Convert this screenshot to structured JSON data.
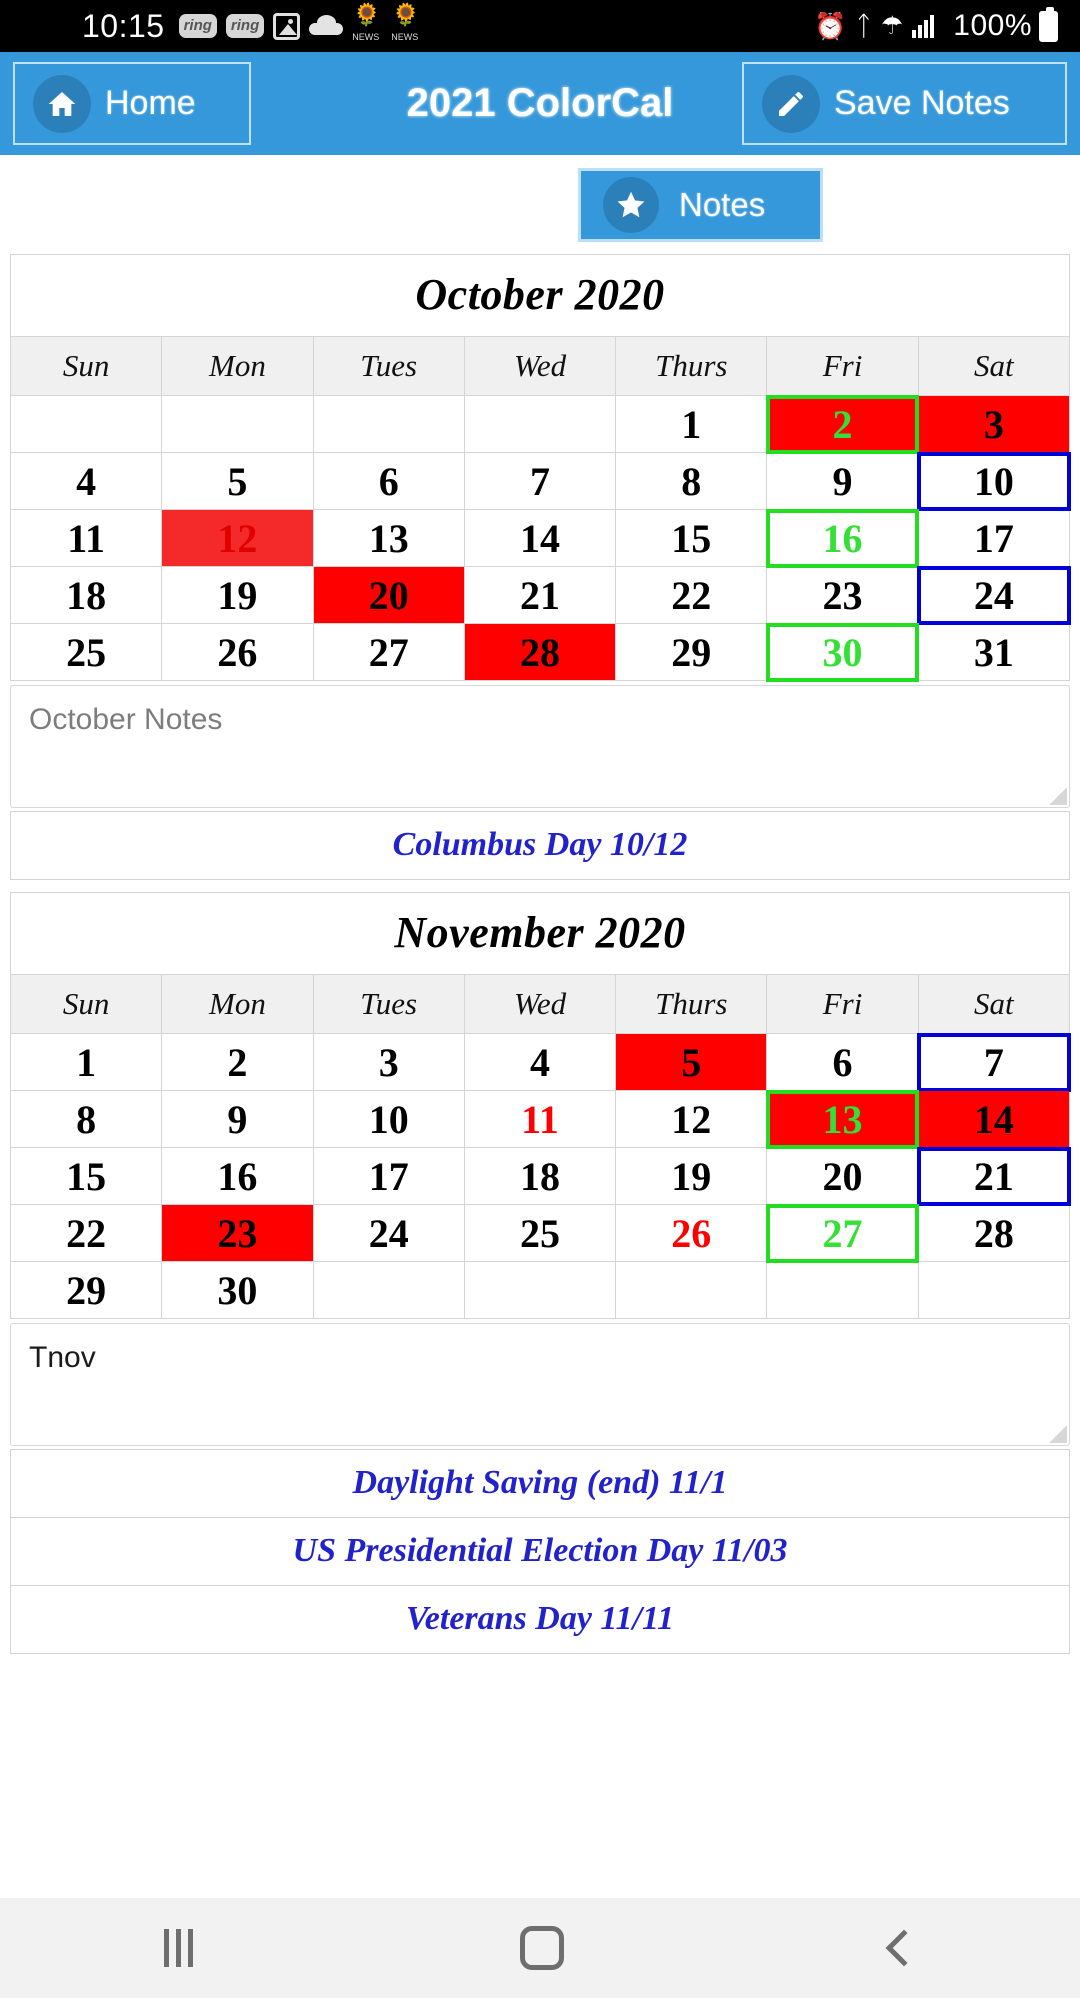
{
  "status_bar": {
    "clock": "10:15",
    "battery_percent": "100%",
    "icons": [
      "ring-icon",
      "ring-icon",
      "image-icon",
      "cloud-icon",
      "nbc-news-icon",
      "nbc-news-icon",
      "alarm-icon",
      "bluetooth-icon",
      "wifi-icon",
      "signal-icon",
      "battery-icon"
    ],
    "ring_label": "ring",
    "nbc_label": "NEWS"
  },
  "header": {
    "home_label": "Home",
    "title": "2021 ColorCal",
    "save_notes_label": "Save Notes",
    "accent_color": "#3498db"
  },
  "toolbar": {
    "notes_label": "Notes"
  },
  "colors": {
    "red_bg": "#fe0000",
    "green_text": "#33e033",
    "green_border": "#22dd22",
    "blue_border": "#0000d8",
    "holiday_text": "#2222cc"
  },
  "months": [
    {
      "title": "October 2020",
      "dow": [
        "Sun",
        "Mon",
        "Tues",
        "Wed",
        "Thurs",
        "Fri",
        "Sat"
      ],
      "weeks": [
        [
          {
            "n": ""
          },
          {
            "n": ""
          },
          {
            "n": ""
          },
          {
            "n": ""
          },
          {
            "n": "1"
          },
          {
            "n": "2",
            "bg": "red",
            "text": "green",
            "border": "green"
          },
          {
            "n": "3",
            "bg": "red"
          }
        ],
        [
          {
            "n": "4"
          },
          {
            "n": "5"
          },
          {
            "n": "6"
          },
          {
            "n": "7"
          },
          {
            "n": "8"
          },
          {
            "n": "9"
          },
          {
            "n": "10",
            "border": "blue"
          }
        ],
        [
          {
            "n": "11"
          },
          {
            "n": "12",
            "bg": "red2",
            "text": "dred"
          },
          {
            "n": "13"
          },
          {
            "n": "14"
          },
          {
            "n": "15"
          },
          {
            "n": "16",
            "text": "green",
            "border": "green"
          },
          {
            "n": "17"
          }
        ],
        [
          {
            "n": "18"
          },
          {
            "n": "19"
          },
          {
            "n": "20",
            "bg": "red"
          },
          {
            "n": "21"
          },
          {
            "n": "22"
          },
          {
            "n": "23"
          },
          {
            "n": "24",
            "border": "blue"
          }
        ],
        [
          {
            "n": "25"
          },
          {
            "n": "26"
          },
          {
            "n": "27"
          },
          {
            "n": "28",
            "bg": "red"
          },
          {
            "n": "29"
          },
          {
            "n": "30",
            "text": "green",
            "border": "green"
          },
          {
            "n": "31"
          }
        ]
      ],
      "note": {
        "value": "",
        "placeholder": "October Notes"
      },
      "holidays": [
        "Columbus Day 10/12"
      ]
    },
    {
      "title": "November 2020",
      "dow": [
        "Sun",
        "Mon",
        "Tues",
        "Wed",
        "Thurs",
        "Fri",
        "Sat"
      ],
      "weeks": [
        [
          {
            "n": "1"
          },
          {
            "n": "2"
          },
          {
            "n": "3"
          },
          {
            "n": "4"
          },
          {
            "n": "5",
            "bg": "red"
          },
          {
            "n": "6"
          },
          {
            "n": "7",
            "border": "blue"
          }
        ],
        [
          {
            "n": "8"
          },
          {
            "n": "9"
          },
          {
            "n": "10"
          },
          {
            "n": "11",
            "text": "red"
          },
          {
            "n": "12"
          },
          {
            "n": "13",
            "bg": "red",
            "text": "green",
            "border": "green"
          },
          {
            "n": "14",
            "bg": "red"
          }
        ],
        [
          {
            "n": "15"
          },
          {
            "n": "16"
          },
          {
            "n": "17"
          },
          {
            "n": "18"
          },
          {
            "n": "19"
          },
          {
            "n": "20"
          },
          {
            "n": "21",
            "border": "blue"
          }
        ],
        [
          {
            "n": "22"
          },
          {
            "n": "23",
            "bg": "red"
          },
          {
            "n": "24"
          },
          {
            "n": "25"
          },
          {
            "n": "26",
            "text": "red"
          },
          {
            "n": "27",
            "text": "green",
            "border": "green"
          },
          {
            "n": "28"
          }
        ],
        [
          {
            "n": "29"
          },
          {
            "n": "30"
          },
          {
            "n": ""
          },
          {
            "n": ""
          },
          {
            "n": ""
          },
          {
            "n": ""
          },
          {
            "n": ""
          }
        ]
      ],
      "note": {
        "value": "Tnov",
        "placeholder": ""
      },
      "holidays": [
        "Daylight Saving (end) 11/1",
        "US Presidential Election Day 11/03",
        "Veterans Day 11/11"
      ]
    }
  ],
  "nav_bar": {
    "recent_label": "recent-apps-icon",
    "home_label": "home-icon",
    "back_label": "back-icon"
  }
}
